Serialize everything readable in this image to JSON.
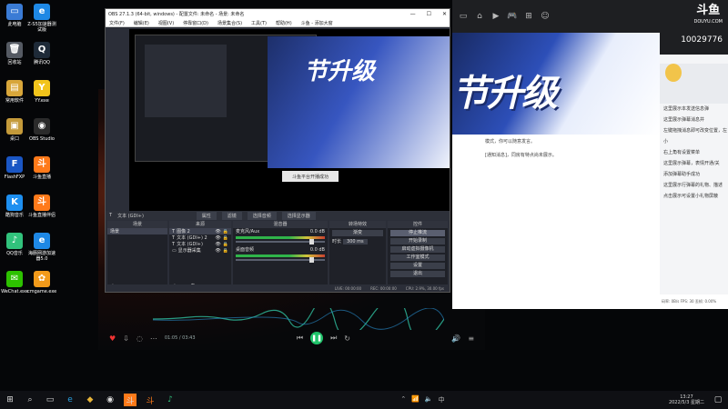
{
  "desktop_icons": [
    {
      "label": "此电脑",
      "glyph": "▭",
      "color": "#3a7bd5",
      "icon": "computer-icon"
    },
    {
      "label": "Z-S5加速器测试版",
      "glyph": "e",
      "color": "#1e88e5",
      "icon": "browser-icon"
    },
    {
      "label": "回收站",
      "glyph": "🗑",
      "color": "#555a63",
      "icon": "recycle-bin-icon"
    },
    {
      "label": "腾讯QQ",
      "glyph": "Q",
      "color": "#1e2a38",
      "icon": "qq-icon"
    },
    {
      "label": "常用软件",
      "glyph": "▤",
      "color": "#d8a63a",
      "icon": "folder-icon"
    },
    {
      "label": "YY.exe",
      "glyph": "Y",
      "color": "#f2c41b",
      "icon": "yy-icon"
    },
    {
      "label": "桌口",
      "glyph": "▣",
      "color": "#c49a3a",
      "icon": "folder-icon"
    },
    {
      "label": "OBS Studio",
      "glyph": "◉",
      "color": "#2b2b2b",
      "icon": "obs-icon"
    },
    {
      "label": "FlashFXP",
      "glyph": "F",
      "color": "#1a56c4",
      "icon": "flash-icon"
    },
    {
      "label": "斗鱼直播",
      "glyph": "斗",
      "color": "#ff7a1a",
      "icon": "douyu-icon"
    },
    {
      "label": "酷狗音乐",
      "glyph": "K",
      "color": "#1d8ff0",
      "icon": "kugou-icon"
    },
    {
      "label": "斗鱼直播伴侣",
      "glyph": "斗",
      "color": "#ff7a1a",
      "icon": "douyu-companion-icon"
    },
    {
      "label": "QQ音乐",
      "glyph": "♪",
      "color": "#31c27c",
      "icon": "qqmusic-icon"
    },
    {
      "label": "海豚网游加速器5.0",
      "glyph": "e",
      "color": "#1e88e5",
      "icon": "accelerator-icon"
    },
    {
      "label": "WeChat.exe",
      "glyph": "✉",
      "color": "#2dc100",
      "icon": "wechat-icon"
    },
    {
      "label": "cmgame.exe",
      "glyph": "✿",
      "color": "#f29a1a",
      "icon": "cmgame-icon"
    }
  ],
  "obs": {
    "title": "OBS 27.1.3 (64-bit, windows) - 配置文件: 未命名 - 场景: 未命名",
    "menu": [
      "文件(F)",
      "编辑(E)",
      "视图(V)",
      "停靠窗口(D)",
      "场景集合(S)",
      "工具(T)",
      "帮助(H)",
      "斗鱼 - 添加大窗"
    ],
    "popup_text": "斗鱼平台开播成功",
    "preview_banner": "节升级",
    "source_bar": {
      "current": "文本 (GDI+)",
      "properties": "属性",
      "filters": "滤镜",
      "select_source": "选择音频",
      "select_display": "选择显示器"
    },
    "docks": {
      "scenes": {
        "header": "场景",
        "items": [
          "场景"
        ]
      },
      "sources": {
        "header": "来源",
        "items": [
          "图像 2",
          "文本 (GDI+) 2",
          "文本 (GDI+)",
          "显示器采集"
        ]
      },
      "mixer": {
        "header": "混音器",
        "channels": [
          {
            "name": "麦克风/Aux",
            "db": "0.0 dB"
          },
          {
            "name": "桌面音频",
            "db": "0.0 dB"
          }
        ]
      },
      "transitions": {
        "header": "转场特效",
        "type": "渐变",
        "duration_label": "时长",
        "duration": "300 ms"
      },
      "controls": {
        "header": "控件",
        "buttons": [
          "停止推流",
          "开始录制",
          "启动虚拟摄像机",
          "工作室模式",
          "设置",
          "退出"
        ]
      }
    },
    "status": {
      "live": "LIVE: 00:00:00",
      "rec": "REC: 00:00:00",
      "cpu": "CPU: 2.9%, 30.00 fps"
    }
  },
  "player": {
    "time": "01:05 / 03:43"
  },
  "douyu": {
    "logo_main": "斗鱼",
    "logo_sub": "DOUYU.COM",
    "room_count": "10029776",
    "banner_title": "节升级",
    "content_lines": [
      "模式，你可以随意发言。",
      "[通知消息]，同房有特点尚未展示。"
    ],
    "chat": [
      "这里展示本发送信息弹",
      "这里展示弹幕消息并",
      "左键拖拽消息即可改变位置，左",
      "小",
      "右上角有设置菜单",
      "这里展示弹幕，表情开通/关",
      "添加弹幕助手成功",
      "这里展示行弹幕的礼物、描述",
      "点击展示可设置小礼物屏蔽"
    ],
    "bottom": "码率: 0B/s FPS: 30 丢帧: 0.00%"
  },
  "taskbar": {
    "time": "13:27",
    "date": "2022/5/3 星期二"
  }
}
